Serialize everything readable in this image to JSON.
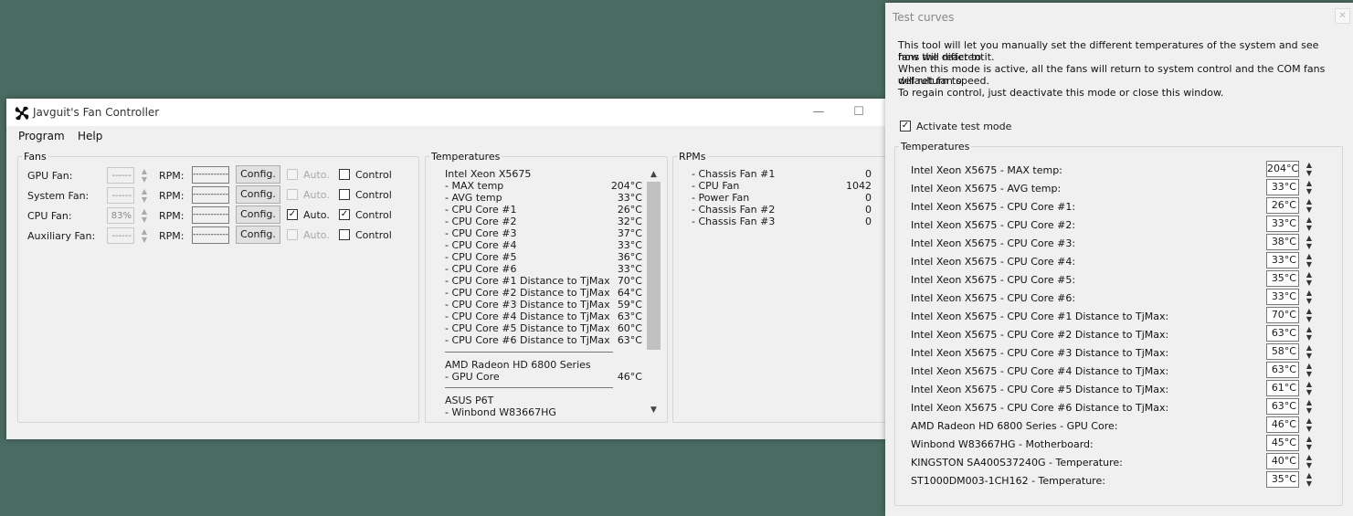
{
  "main_window": {
    "title": "Javguit's Fan Controller",
    "controls": {
      "minimize": "—",
      "maximize": "☐"
    },
    "menu": [
      "Program",
      "Help"
    ],
    "fans_group": {
      "title": "Fans",
      "rows": [
        {
          "label": "GPU Fan:",
          "percent": "",
          "percent_dashes": "------",
          "rpm_label": "RPM:",
          "rpm_value": "------------",
          "config_label": "Config.",
          "auto_label": "Auto.",
          "auto_checked": false,
          "auto_enabled": false,
          "control_label": "Control",
          "control_checked": false
        },
        {
          "label": "System Fan:",
          "percent": "",
          "percent_dashes": "------",
          "rpm_label": "RPM:",
          "rpm_value": "------------",
          "config_label": "Config.",
          "auto_label": "Auto.",
          "auto_checked": false,
          "auto_enabled": false,
          "control_label": "Control",
          "control_checked": false
        },
        {
          "label": "CPU Fan:",
          "percent": "83%",
          "percent_dashes": "83%",
          "rpm_label": "RPM:",
          "rpm_value": "------------",
          "config_label": "Config.",
          "auto_label": "Auto.",
          "auto_checked": true,
          "auto_enabled": true,
          "control_label": "Control",
          "control_checked": true
        },
        {
          "label": "Auxiliary Fan:",
          "percent": "",
          "percent_dashes": "------",
          "rpm_label": "RPM:",
          "rpm_value": "------------",
          "config_label": "Config.",
          "auto_label": "Auto.",
          "auto_checked": false,
          "auto_enabled": false,
          "control_label": "Control",
          "control_checked": false
        }
      ]
    },
    "temperatures_group": {
      "title": "Temperatures",
      "lines": [
        {
          "name": "Intel Xeon X5675",
          "value": ""
        },
        {
          "name": "- MAX temp",
          "value": "204°C"
        },
        {
          "name": "- AVG temp",
          "value": "33°C"
        },
        {
          "name": "- CPU Core #1",
          "value": "26°C"
        },
        {
          "name": "- CPU Core #2",
          "value": "32°C"
        },
        {
          "name": "- CPU Core #3",
          "value": "37°C"
        },
        {
          "name": "- CPU Core #4",
          "value": "33°C"
        },
        {
          "name": "- CPU Core #5",
          "value": "36°C"
        },
        {
          "name": "- CPU Core #6",
          "value": "33°C"
        },
        {
          "name": "- CPU Core #1 Distance to TjMax",
          "value": "70°C"
        },
        {
          "name": "- CPU Core #2 Distance to TjMax",
          "value": "64°C"
        },
        {
          "name": "- CPU Core #3 Distance to TjMax",
          "value": "59°C"
        },
        {
          "name": "- CPU Core #4 Distance to TjMax",
          "value": "63°C"
        },
        {
          "name": "- CPU Core #5 Distance to TjMax",
          "value": "60°C"
        },
        {
          "name": "- CPU Core #6 Distance to TjMax",
          "value": "63°C"
        },
        {
          "name": "AMD Radeon HD 6800 Series",
          "value": ""
        },
        {
          "name": "- GPU Core",
          "value": "46°C"
        },
        {
          "name": "ASUS P6T",
          "value": ""
        },
        {
          "name": " - Winbond W83667HG",
          "value": ""
        }
      ],
      "scroll_up": "▲",
      "scroll_down": "▼"
    },
    "rpms_group": {
      "title": "RPMs",
      "lines": [
        {
          "name": "- Chassis Fan #1",
          "value": "0"
        },
        {
          "name": "- CPU Fan",
          "value": "1042"
        },
        {
          "name": "- Power Fan",
          "value": "0"
        },
        {
          "name": "- Chassis Fan #2",
          "value": "0"
        },
        {
          "name": "- Chassis Fan #3",
          "value": "0"
        }
      ]
    }
  },
  "test_window": {
    "title": "Test curves",
    "close": "✕",
    "description": [
      "  This tool will let you manually set the different temperatures of the system and see how the different",
      "fans will react to it.",
      "  When this mode is active, all the fans will return to system control and the COM fans will return to",
      "default fan speed.",
      "  To regain control, just deactivate this mode or close this window."
    ],
    "activate_label": "Activate test mode",
    "activate_checked": true,
    "temperatures_title": "Temperatures",
    "sensors": [
      {
        "label": "Intel Xeon X5675 - MAX temp:",
        "value": "204°C"
      },
      {
        "label": "Intel Xeon X5675 - AVG temp:",
        "value": "33°C"
      },
      {
        "label": "Intel Xeon X5675 - CPU Core #1:",
        "value": "26°C"
      },
      {
        "label": "Intel Xeon X5675 - CPU Core #2:",
        "value": "33°C"
      },
      {
        "label": "Intel Xeon X5675 - CPU Core #3:",
        "value": "38°C"
      },
      {
        "label": "Intel Xeon X5675 - CPU Core #4:",
        "value": "33°C"
      },
      {
        "label": "Intel Xeon X5675 - CPU Core #5:",
        "value": "35°C"
      },
      {
        "label": "Intel Xeon X5675 - CPU Core #6:",
        "value": "33°C"
      },
      {
        "label": "Intel Xeon X5675 - CPU Core #1 Distance to TjMax:",
        "value": "70°C"
      },
      {
        "label": "Intel Xeon X5675 - CPU Core #2 Distance to TjMax:",
        "value": "63°C"
      },
      {
        "label": "Intel Xeon X5675 - CPU Core #3 Distance to TjMax:",
        "value": "58°C"
      },
      {
        "label": "Intel Xeon X5675 - CPU Core #4 Distance to TjMax:",
        "value": "63°C"
      },
      {
        "label": "Intel Xeon X5675 - CPU Core #5 Distance to TjMax:",
        "value": "61°C"
      },
      {
        "label": "Intel Xeon X5675 - CPU Core #6 Distance to TjMax:",
        "value": "63°C"
      },
      {
        "label": "AMD Radeon HD 6800 Series - GPU Core:",
        "value": "46°C"
      },
      {
        "label": "Winbond W83667HG - Motherboard:",
        "value": "45°C"
      },
      {
        "label": "KINGSTON SA400S37240G - Temperature:",
        "value": "40°C"
      },
      {
        "label": "ST1000DM003-1CH162 - Temperature:",
        "value": "35°C"
      }
    ]
  }
}
